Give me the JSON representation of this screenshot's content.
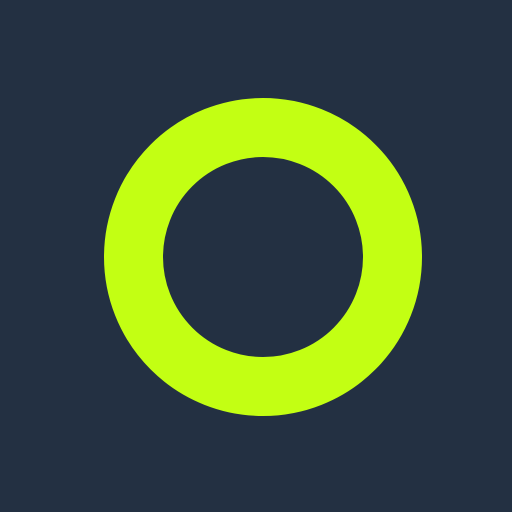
{
  "colors": {
    "background": "#233042",
    "accent": "#c3ff13"
  },
  "icon": {
    "name": "ring-logo-icon"
  }
}
